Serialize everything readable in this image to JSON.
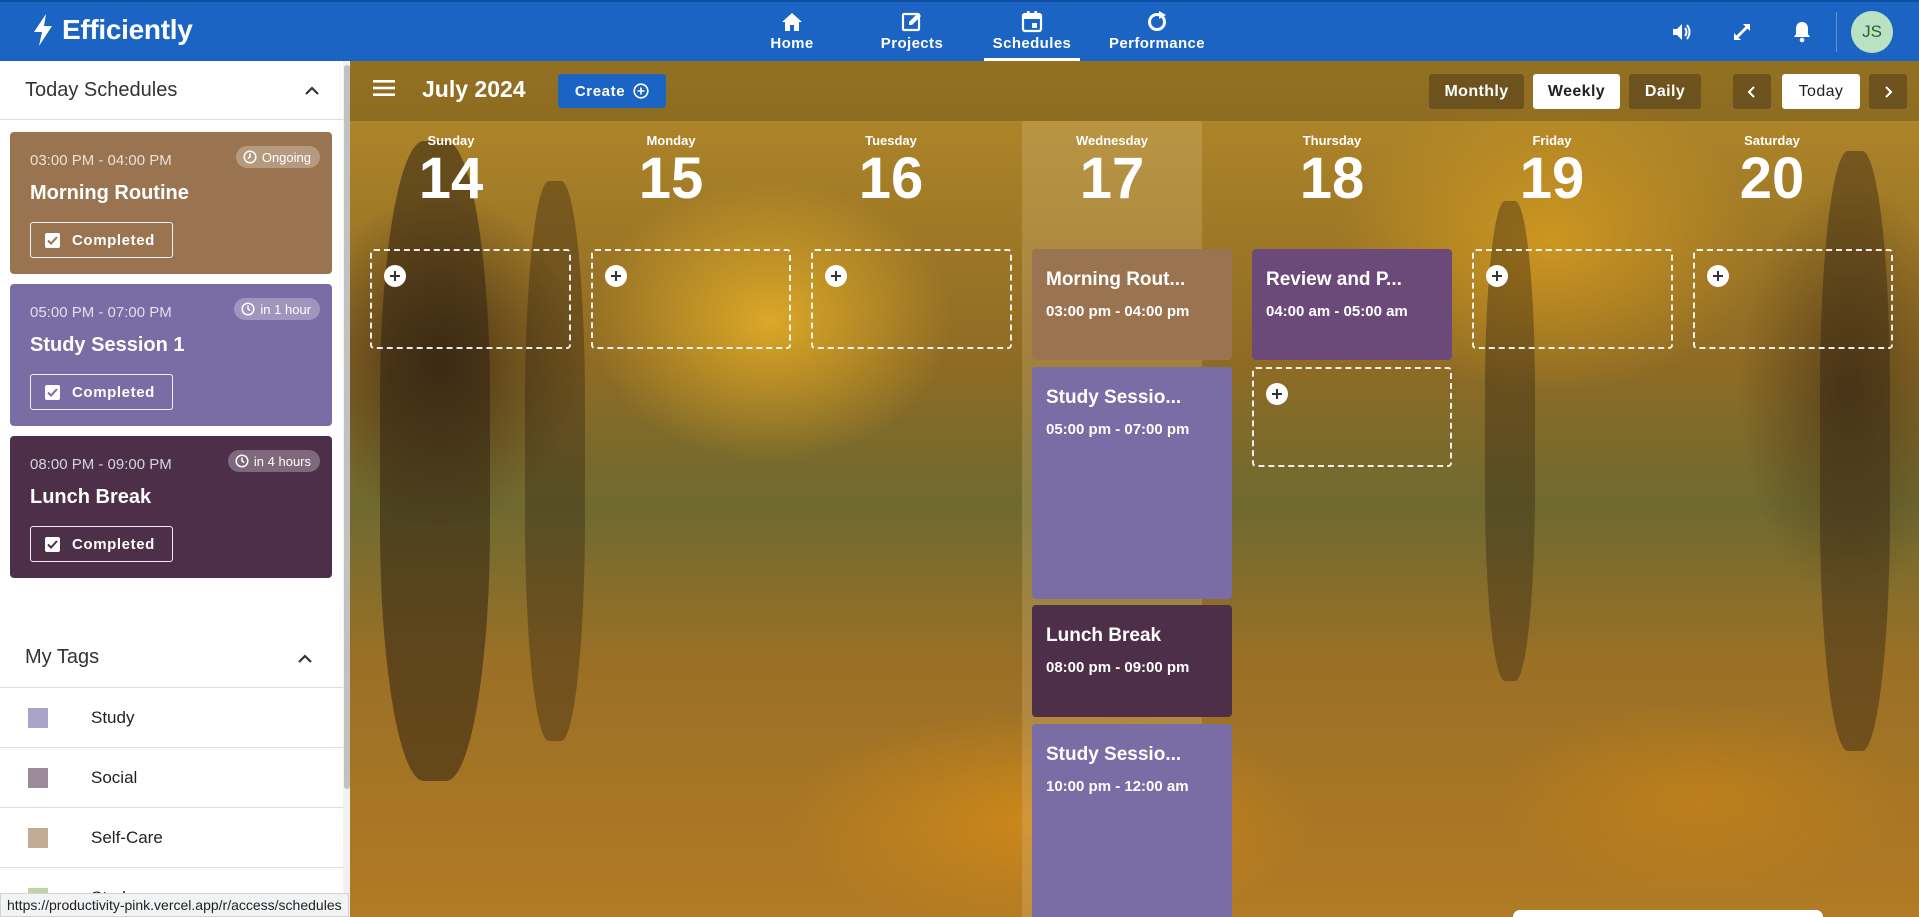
{
  "app": {
    "name": "Efficiently"
  },
  "nav": [
    {
      "label": "Home",
      "icon": "home-icon"
    },
    {
      "label": "Projects",
      "icon": "edit-icon"
    },
    {
      "label": "Schedules",
      "icon": "calendar-icon",
      "active": true
    },
    {
      "label": "Performance",
      "icon": "refresh-icon"
    }
  ],
  "top_icons": [
    "volume-icon",
    "fullscreen-icon",
    "bell-icon"
  ],
  "user": {
    "initials": "JS"
  },
  "sidebar": {
    "today_title": "Today Schedules",
    "schedules": [
      {
        "time": "03:00 PM - 04:00 PM",
        "badge": "Ongoing",
        "title": "Morning Routine",
        "button": "Completed",
        "color": "#9a7450"
      },
      {
        "time": "05:00 PM - 07:00 PM",
        "badge": "in 1 hour",
        "title": "Study Session 1",
        "button": "Completed",
        "color": "#7a6ca4"
      },
      {
        "time": "08:00 PM - 09:00 PM",
        "badge": "in 4 hours",
        "title": "Lunch Break",
        "button": "Completed",
        "color": "#4e2f4a"
      }
    ],
    "tags_title": "My Tags",
    "tags": [
      {
        "name": "Study",
        "color": "#a8a5c9"
      },
      {
        "name": "Social",
        "color": "#9d8b9c"
      },
      {
        "name": "Self-Care",
        "color": "#c2ab97"
      },
      {
        "name": "Study",
        "color": "#c0d6a2"
      }
    ]
  },
  "calendar": {
    "month_title": "July 2024",
    "create_label": "Create",
    "views": [
      "Monthly",
      "Weekly",
      "Daily"
    ],
    "active_view": "Weekly",
    "today_label": "Today",
    "days": [
      {
        "dow": "Sunday",
        "num": "14"
      },
      {
        "dow": "Monday",
        "num": "15"
      },
      {
        "dow": "Tuesday",
        "num": "16"
      },
      {
        "dow": "Wednesday",
        "num": "17"
      },
      {
        "dow": "Thursday",
        "num": "18"
      },
      {
        "dow": "Friday",
        "num": "19"
      },
      {
        "dow": "Saturday",
        "num": "20"
      }
    ],
    "events": {
      "wednesday": [
        {
          "title": "Morning Rout...",
          "time": "03:00 pm - 04:00 pm",
          "color": "#9a7450"
        },
        {
          "title": "Study Sessio...",
          "time": "05:00 pm - 07:00 pm",
          "color": "#7a6ca4"
        },
        {
          "title": "Lunch Break",
          "time": "08:00 pm - 09:00 pm",
          "color": "#4e2f4a"
        },
        {
          "title": "Study Sessio...",
          "time": "10:00 pm - 12:00 am",
          "color": "#7a6ca4"
        }
      ],
      "thursday": [
        {
          "title": "Review and P...",
          "time": "04:00 am - 05:00 am",
          "color": "#6b4a7a"
        }
      ]
    }
  },
  "status_url": "https://productivity-pink.vercel.app/r/access/schedules"
}
